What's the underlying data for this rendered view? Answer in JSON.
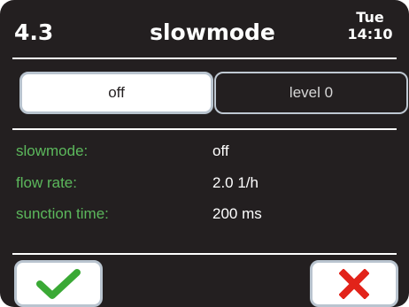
{
  "header": {
    "menu_number": "4.3",
    "title": "slowmode",
    "day": "Tue",
    "time": "14:10"
  },
  "options": [
    {
      "label": "off",
      "selected": true
    },
    {
      "label": "level 0",
      "selected": false
    }
  ],
  "info": [
    {
      "label": "slowmode:",
      "value": "off"
    },
    {
      "label": "flow rate:",
      "value": "2.0 1/h"
    },
    {
      "label": "sunction time:",
      "value": "200 ms"
    }
  ],
  "actions": {
    "confirm_icon": "checkmark-icon",
    "cancel_icon": "cross-icon"
  },
  "colors": {
    "background": "#231f20",
    "label_green": "#5cb85c",
    "confirm_green": "#3aa935",
    "cancel_red": "#e2231a"
  }
}
